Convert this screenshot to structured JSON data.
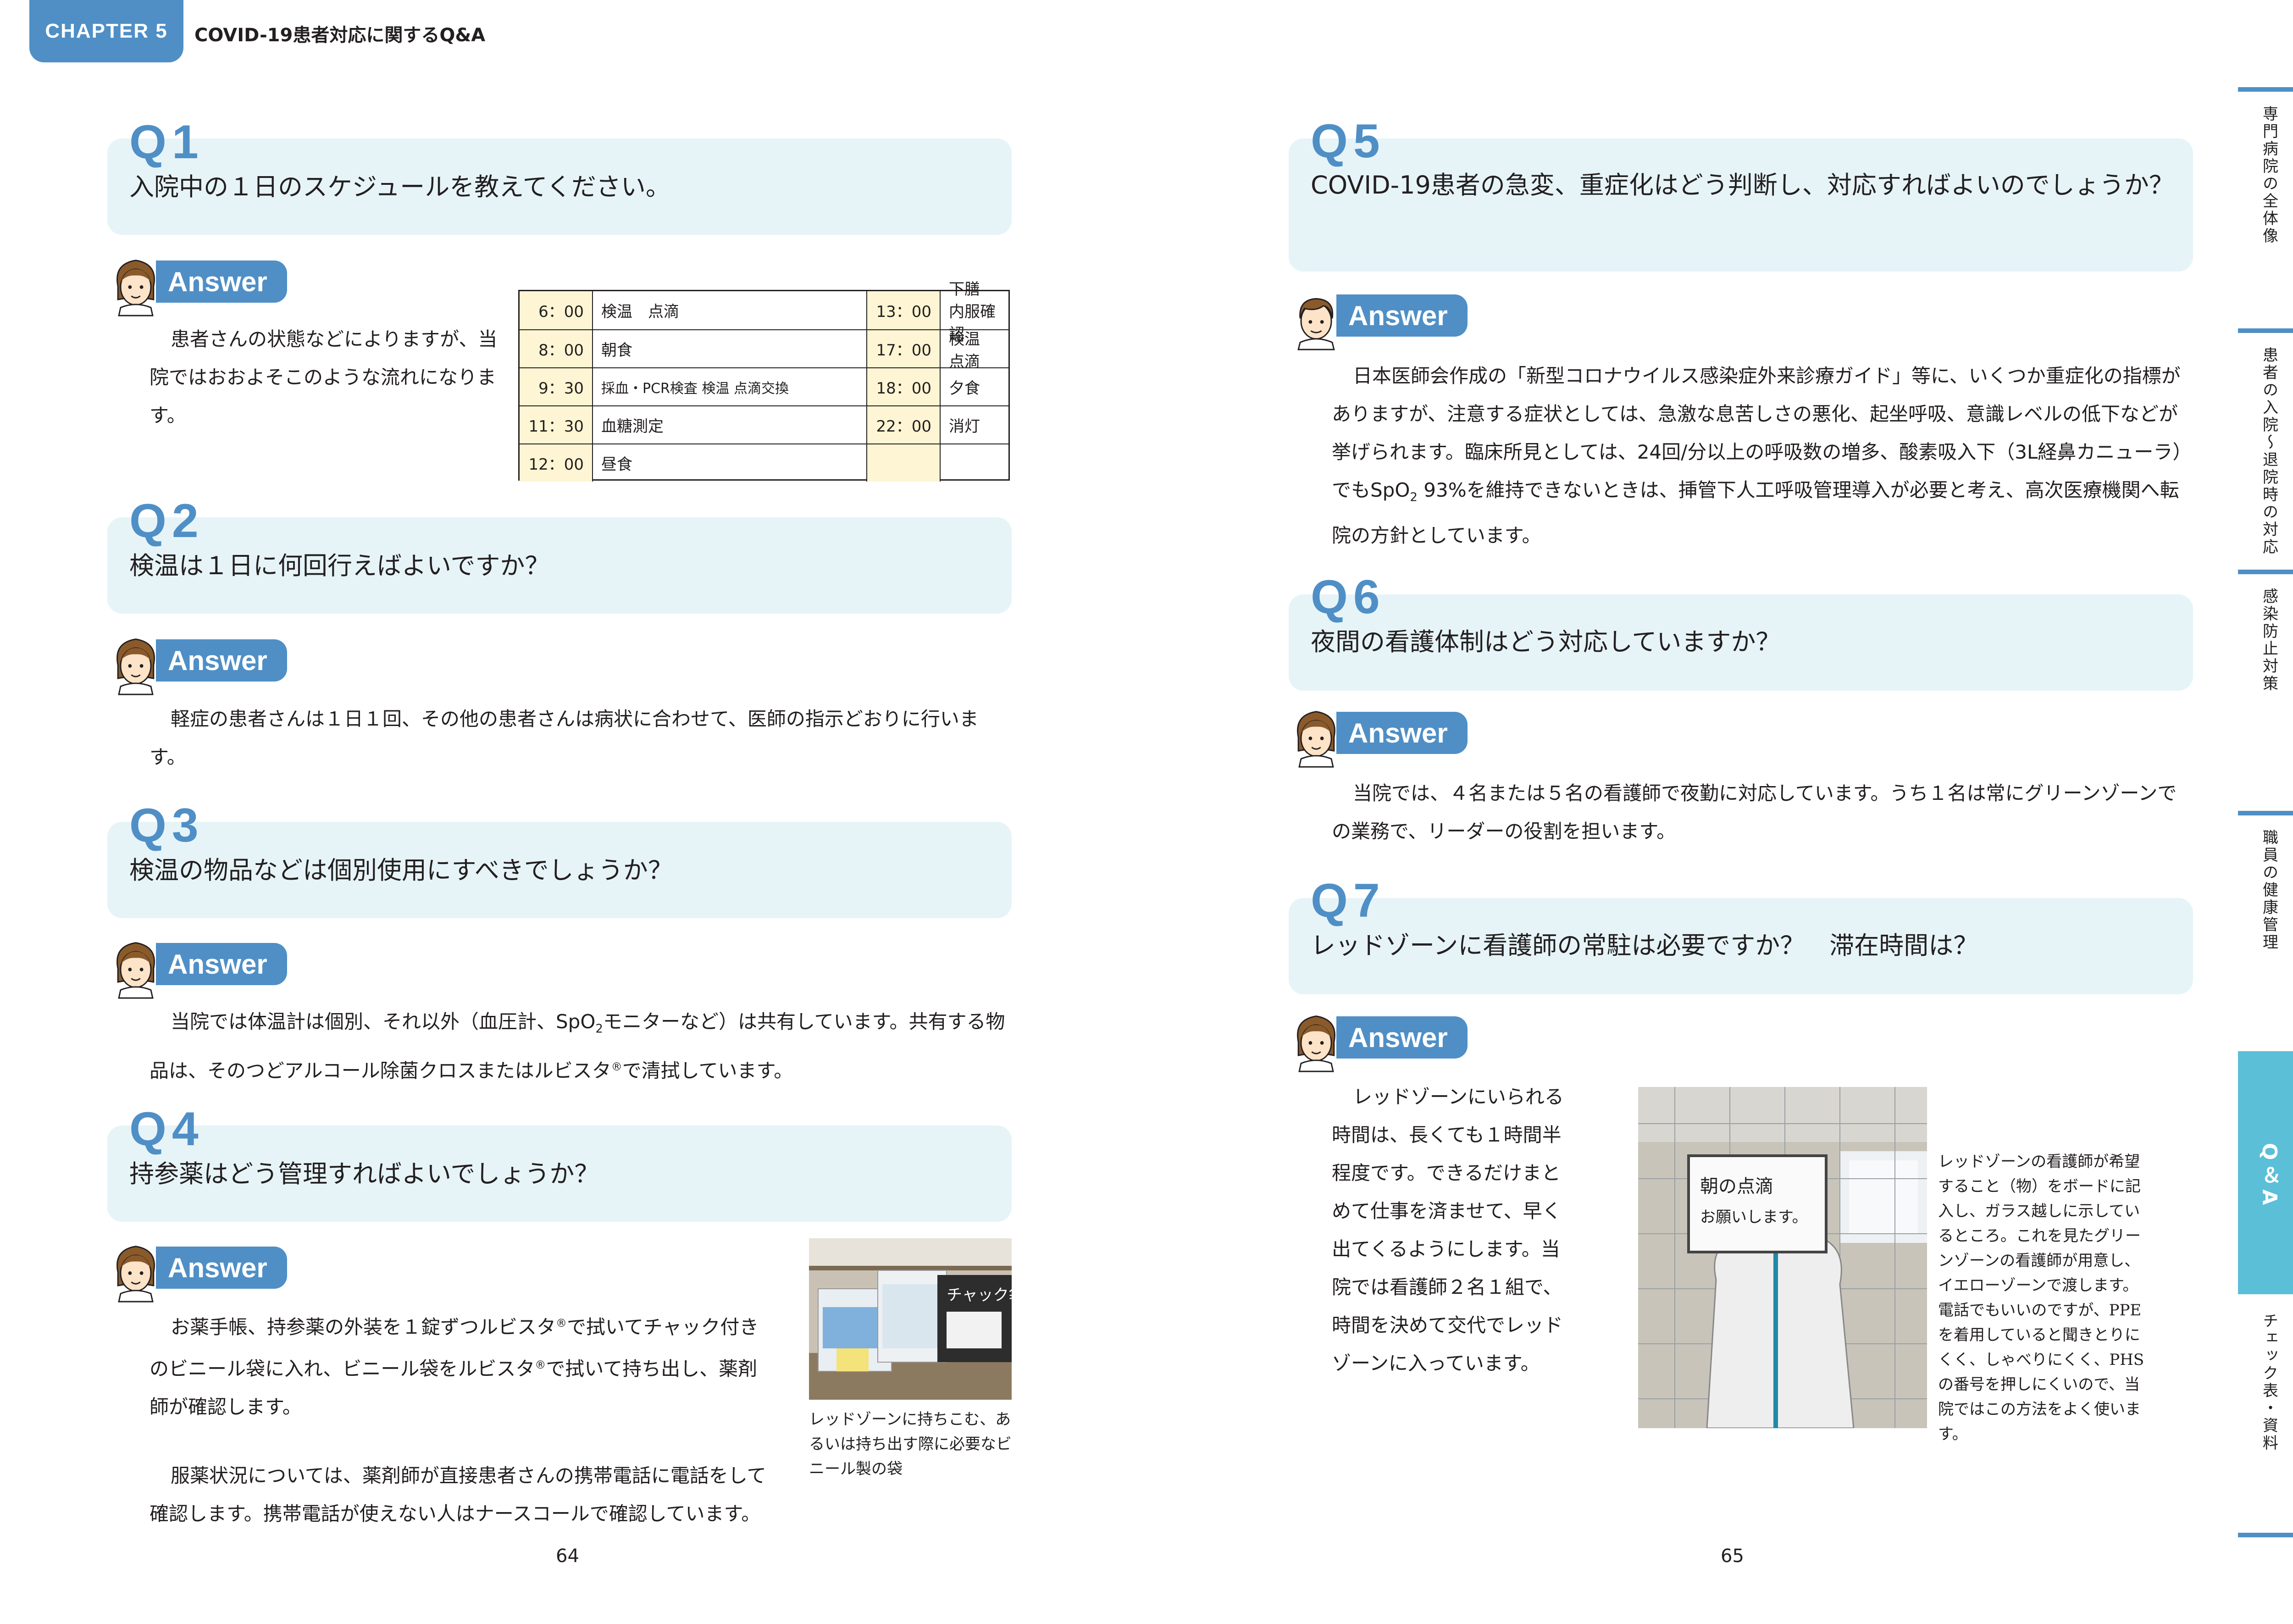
{
  "header": {
    "chapter": "CHAPTER 5",
    "title": "COVID-19患者対応に関するQ&A"
  },
  "answer_label": "Answer",
  "q1": {
    "num": "Q1",
    "question": "入院中の１日のスケジュールを教えてください。",
    "answer": "患者さんの状態などによりますが、当院ではおおよそこのような流れになります。"
  },
  "schedule": {
    "rows": [
      {
        "t1": "6：00",
        "a1": "検温　点滴",
        "t2": "13：00",
        "a2": "下膳　内服確認"
      },
      {
        "t1": "8：00",
        "a1": "朝食",
        "t2": "17：00",
        "a2": "検温　点滴"
      },
      {
        "t1": "9：30",
        "a1": "採血・PCR検査  検温  点滴交換",
        "t2": "18：00",
        "a2": "夕食"
      },
      {
        "t1": "11：30",
        "a1": "血糖測定",
        "t2": "22：00",
        "a2": "消灯"
      },
      {
        "t1": "12：00",
        "a1": "昼食",
        "t2": "",
        "a2": ""
      }
    ]
  },
  "q2": {
    "num": "Q2",
    "question": "検温は１日に何回行えばよいですか？",
    "answer": "軽症の患者さんは１日１回、その他の患者さんは病状に合わせて、医師の指示どおりに行います。"
  },
  "q3": {
    "num": "Q3",
    "question": "検温の物品などは個別使用にすべきでしょうか？",
    "answer_a": "当院では体温計は個別、それ以外（血圧計、SpO",
    "answer_sub": "2",
    "answer_b": "モニターなど）は共有しています。共有する物品は、そのつどアルコール除菌クロスまたはルビスタ",
    "answer_reg": "®",
    "answer_c": "で清拭しています。"
  },
  "q4": {
    "num": "Q4",
    "question": "持参薬はどう管理すればよいでしょうか？",
    "answer_p1_a": "お薬手帳、持参薬の外装を１錠ずつルビスタ",
    "answer_p1_b": "で拭いてチャック付きのビニール袋に入れ、ビニール袋をルビスタ",
    "answer_p1_c": "で拭いて持ち出し、薬剤師が確認します。",
    "reg": "®",
    "answer_p2": "服薬状況については、薬剤師が直接患者さんの携帯電話に電話をして確認します。携帯電話が使えない人はナースコールで確認しています。",
    "photo_caption": "レッドゾーンに持ちこむ、あるいは持ち出す際に必要なビニール製の袋",
    "photo_bag_text": "チャック袋"
  },
  "q5": {
    "num": "Q5",
    "question": "COVID-19患者の急変、重症化はどう判断し、対応すればよいのでしょうか？",
    "answer_a": "日本医師会作成の「新型コロナウイルス感染症外来診療ガイド」等に、いくつか重症化の指標がありますが、注意する症状としては、急激な息苦しさの悪化、起坐呼吸、意識レベルの低下などが挙げられます。臨床所見としては、24回/分以上の呼吸数の増多、酸素吸入下（3L経鼻カニューラ）でもSpO",
    "answer_sub": "2",
    "answer_b": " 93%を維持できないときは、挿管下人工呼吸管理導入が必要と考え、高次医療機関へ転院の方針としています。"
  },
  "q6": {
    "num": "Q6",
    "question": "夜間の看護体制はどう対応していますか？",
    "answer": "当院では、４名または５名の看護師で夜勤に対応しています。うち１名は常にグリーンゾーンでの業務で、リーダーの役割を担います。"
  },
  "q7": {
    "num": "Q7",
    "question": "レッドゾーンに看護師の常駐は必要ですか？　滞在時間は？",
    "answer": "レッドゾーンにいられる時間は、長くても１時間半程度です。できるだけまとめて仕事を済ませて、早く出てくるようにします。当院では看護師２名１組で、時間を決めて交代でレッドゾーンに入っています。",
    "photo_caption": "レッドゾーンの看護師が希望すること（物）をボードに記入し、ガラス越しに示しているところ。これを見たグリーンゾーンの看護師が用意し、イエローゾーンで渡します。電話でもいいのですが、PPEを着用していると聞きとりにくく、しゃべりにくく、PHSの番号を押しにくいので、当院ではこの方法をよく使います。",
    "board_line1": "朝の点滴",
    "board_line2": "お願いします。"
  },
  "pages": {
    "left": "64",
    "right": "65"
  },
  "side_index": [
    {
      "label": "専門病院の全体像",
      "active": false
    },
    {
      "label": "患者の入院〜退院時の対応",
      "active": false
    },
    {
      "label": "感染防止対策",
      "active": false
    },
    {
      "label": "職員の健康管理",
      "active": false
    },
    {
      "label": "Q＆A",
      "active": true
    },
    {
      "label": "チェック表・資料",
      "active": false
    }
  ],
  "colors": {
    "accent": "#4f8fc6",
    "question_bg": "#e6f4f8",
    "active_tab": "#5bbfd8",
    "time_cell": "#fdf5d3"
  }
}
